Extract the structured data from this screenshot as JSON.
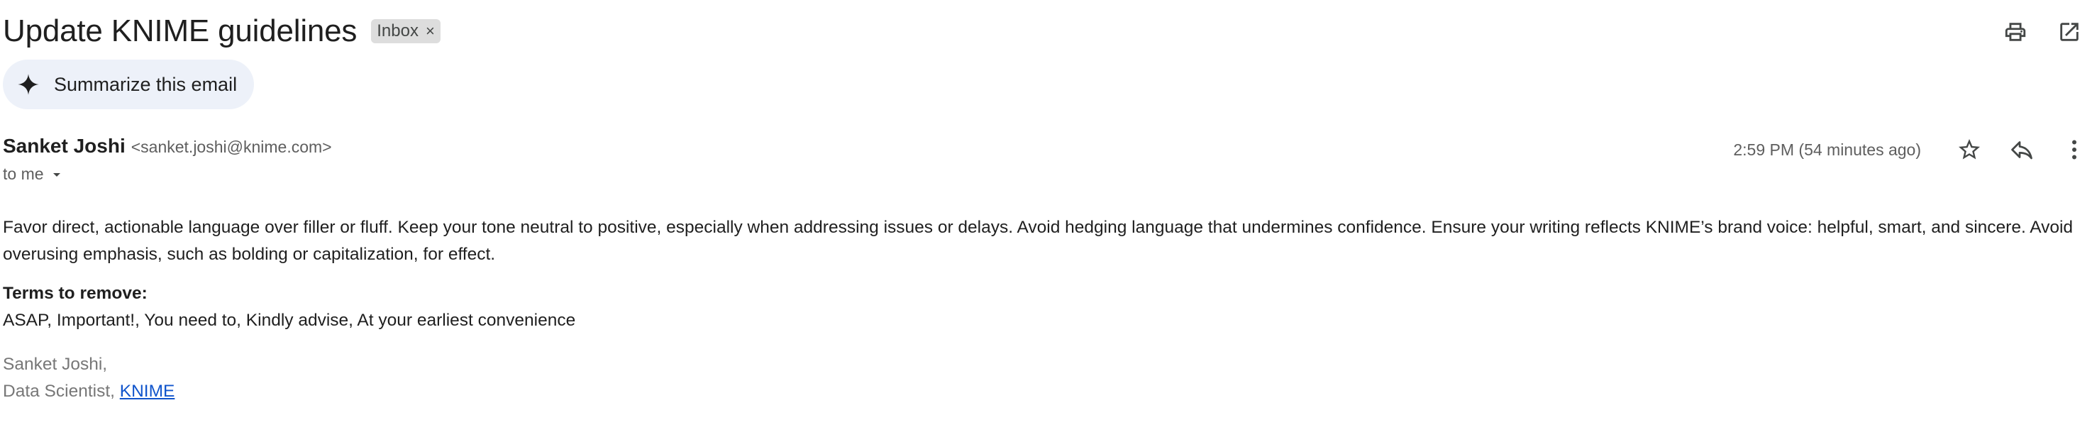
{
  "email": {
    "subject": "Update KNIME guidelines",
    "label": "Inbox",
    "label_remove": "×",
    "summarize_label": "Summarize this email",
    "sender": {
      "name": "Sanket Joshi",
      "email": "<sanket.joshi@knime.com>"
    },
    "recipients": "to me",
    "timestamp": "2:59 PM (54 minutes ago)",
    "body": {
      "paragraph": "Favor direct, actionable language over filler or fluff. Keep your tone neutral to positive, especially when addressing issues or delays. Avoid hedging language that undermines confidence. Ensure your writing reflects KNIME’s brand voice: helpful, smart, and sincere. Avoid overusing emphasis, such as bolding or capitalization, for effect.",
      "terms_heading": "Terms to remove:",
      "terms_list": "ASAP, Important!, You need to, Kindly advise, At your earliest convenience"
    },
    "signature": {
      "name": "Sanket Joshi,",
      "title_prefix": "Data Scientist, ",
      "company_link": "KNIME"
    }
  },
  "icons": {
    "print": "print-icon",
    "open_new_window": "open-in-new-window-icon",
    "sparkle": "sparkle-icon",
    "dropdown": "chevron-down-icon",
    "star": "star-icon",
    "reply": "reply-icon",
    "more": "more-vertical-icon"
  },
  "colors": {
    "link": "#1155cc",
    "chip_background": "#dddddd",
    "summarize_background": "#edf1f9",
    "secondary_text": "#5e5e5e",
    "signature_text": "#777777"
  }
}
